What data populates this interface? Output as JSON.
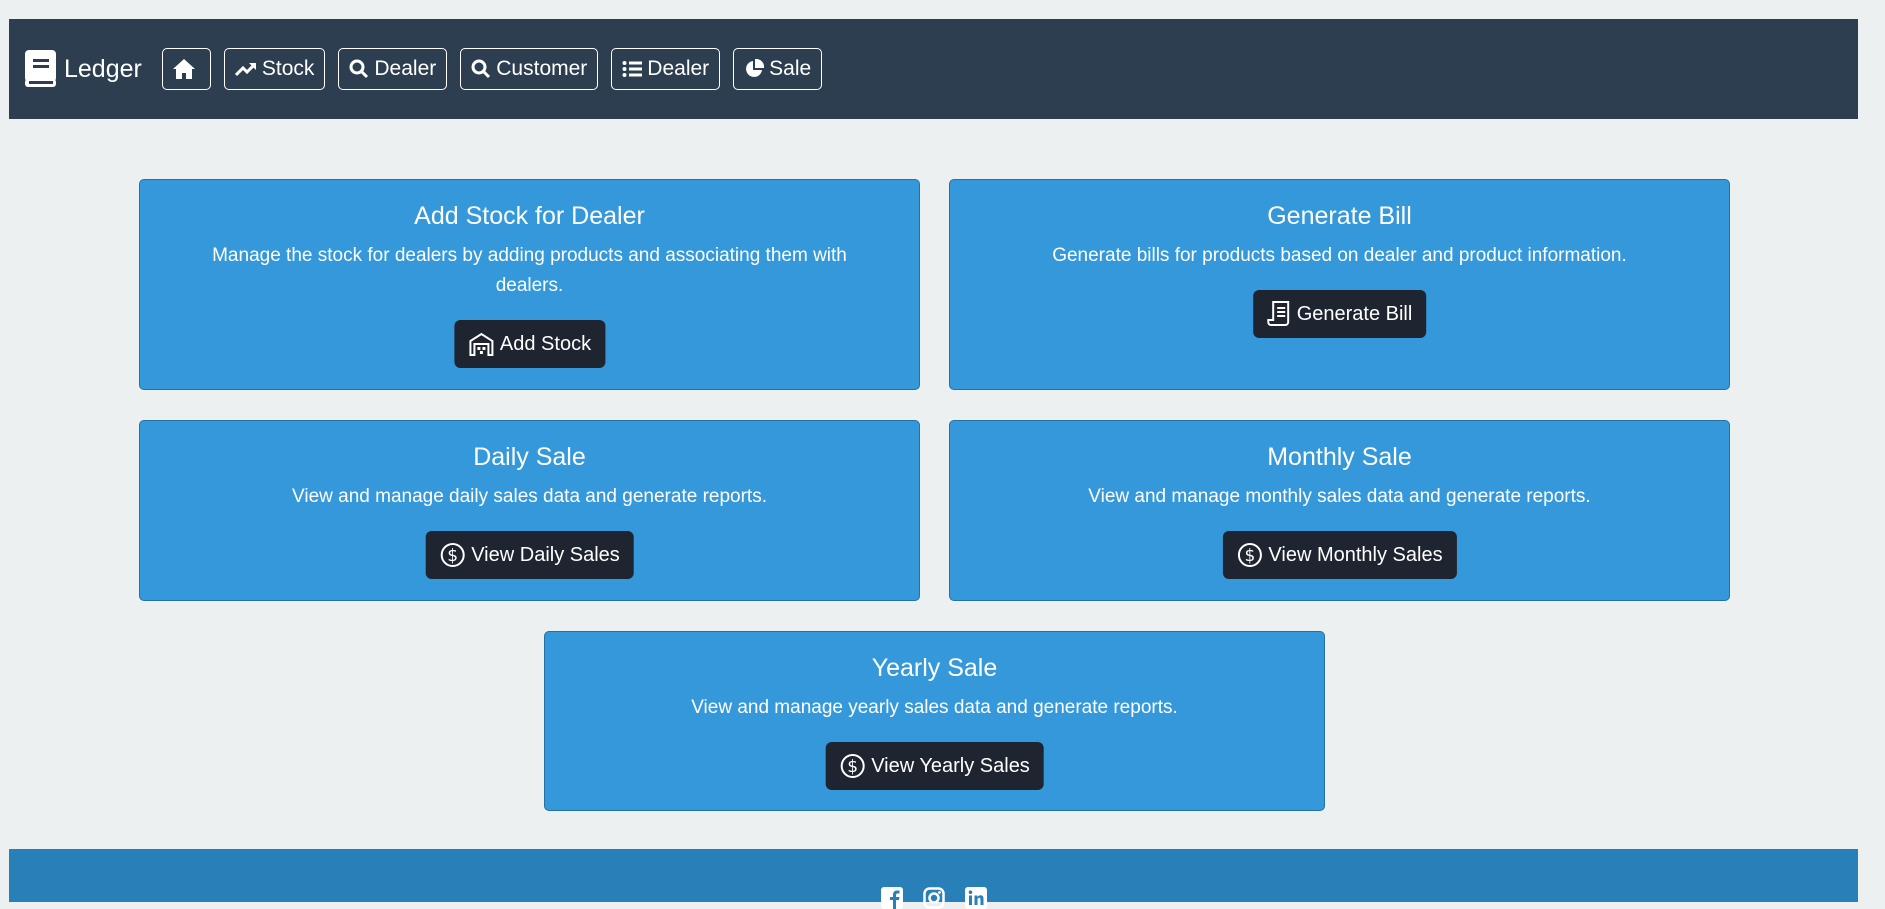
{
  "brand": {
    "title": "Ledger"
  },
  "nav": {
    "items": [
      {
        "label": "Stock",
        "icon": "trending-up-icon"
      },
      {
        "label": "Dealer",
        "icon": "search-icon"
      },
      {
        "label": "Customer",
        "icon": "search-icon"
      },
      {
        "label": "Dealer",
        "icon": "list-icon"
      },
      {
        "label": "Sale",
        "icon": "pie-chart-icon"
      }
    ]
  },
  "cards": {
    "add_stock": {
      "title": "Add Stock for Dealer",
      "description": "Manage the stock for dealers by adding products and associating them with dealers.",
      "button": "Add Stock"
    },
    "generate_bill": {
      "title": "Generate Bill",
      "description": "Generate bills for products based on dealer and product information.",
      "button": "Generate Bill"
    },
    "daily_sale": {
      "title": "Daily Sale",
      "description": "View and manage daily sales data and generate reports.",
      "button": "View Daily Sales"
    },
    "monthly_sale": {
      "title": "Monthly Sale",
      "description": "View and manage monthly sales data and generate reports.",
      "button": "View Monthly Sales"
    },
    "yearly_sale": {
      "title": "Yearly Sale",
      "description": "View and manage yearly sales data and generate reports.",
      "button": "View Yearly Sales"
    }
  },
  "colors": {
    "navbar": "#2c3e50",
    "card": "#3498db",
    "button": "#1e2530",
    "footer": "#2980b9",
    "background": "#ecf0f1"
  }
}
